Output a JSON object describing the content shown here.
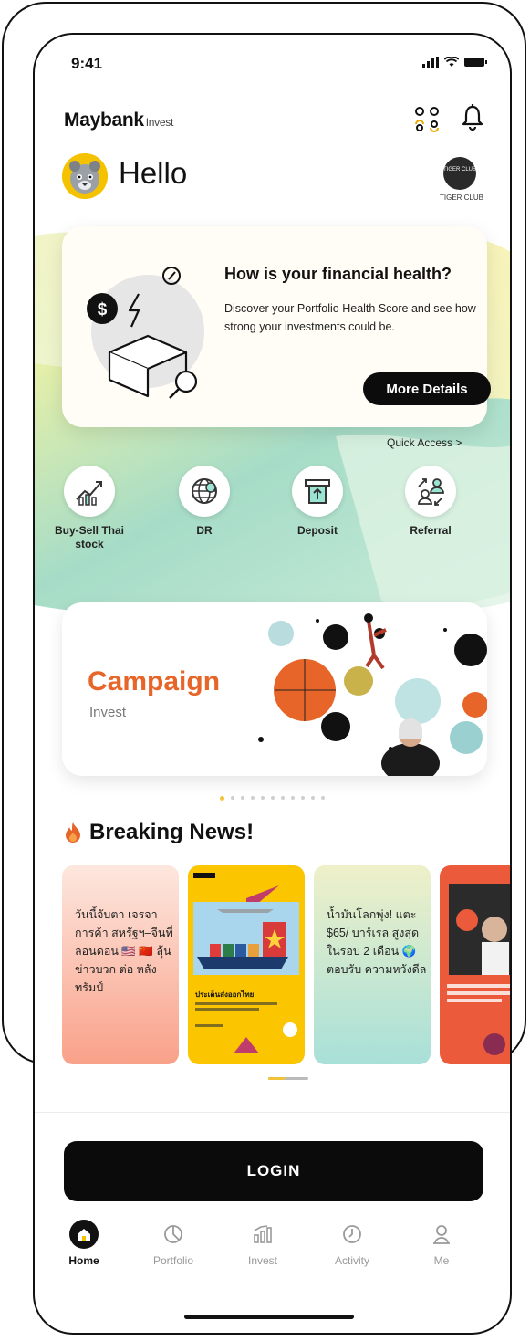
{
  "status_bar": {
    "time": "9:41"
  },
  "header": {
    "brand": "Maybank",
    "brand_sub": "Invest",
    "greeting": "Hello",
    "tiger_badge": "TIGER CLUB",
    "tiger_caption": "TIGER CLUB"
  },
  "health_card": {
    "title": "How is your financial health?",
    "description": "Discover your Portfolio Health Score and see how strong your investments could be.",
    "button": "More Details"
  },
  "quick_access": {
    "link": "Quick Access >",
    "items": [
      {
        "label": "Buy-Sell Thai stock",
        "icon": "stock-chart-icon"
      },
      {
        "label": "DR",
        "icon": "globe-icon"
      },
      {
        "label": "Deposit",
        "icon": "deposit-icon"
      },
      {
        "label": "Referral",
        "icon": "referral-icon"
      }
    ]
  },
  "campaign": {
    "title": "Campaign",
    "subtitle": "Invest",
    "carousel_total": 11,
    "carousel_active": 1
  },
  "news": {
    "heading": "Breaking News!",
    "items": [
      {
        "text": "วันนี้จับตา เจรจาการค้า สหรัฐฯ–จีนที่ ลอนดอน 🇺🇸 🇨🇳 ลุ้นข่าวบวก ต่อ หลังทรัมป์"
      },
      {
        "text": "ประเด็นส่งออกไทย"
      },
      {
        "text": "น้ำมันโลกพุ่ง! แตะ $65/ บาร์เรล สูงสุด ในรอบ 2 เดือน 🌍 ตอบรับ ความหวังดีล"
      },
      {
        "text": ""
      }
    ]
  },
  "login_button": "LOGIN",
  "bottom_nav": [
    {
      "label": "Home",
      "icon": "home-icon",
      "active": true
    },
    {
      "label": "Portfolio",
      "icon": "portfolio-icon",
      "active": false
    },
    {
      "label": "Invest",
      "icon": "invest-icon",
      "active": false
    },
    {
      "label": "Activity",
      "icon": "activity-icon",
      "active": false
    },
    {
      "label": "Me",
      "icon": "profile-icon",
      "active": false
    }
  ],
  "colors": {
    "accent_orange": "#e8652a",
    "brand_yellow": "#f5c200",
    "teal": "#7fd3c5",
    "black": "#0b0b0b"
  }
}
